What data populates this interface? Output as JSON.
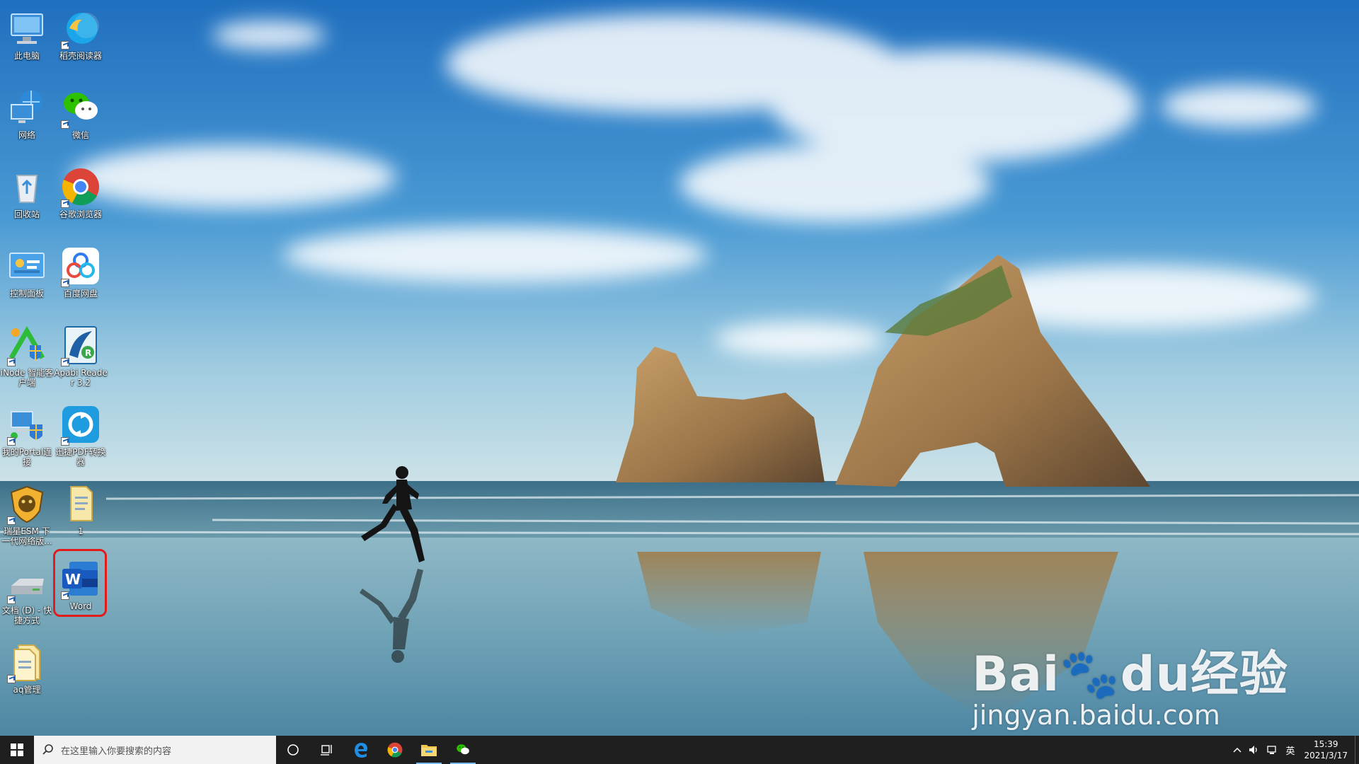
{
  "desktop": {
    "icons": [
      {
        "label": "此电脑",
        "icon": "computer-icon"
      },
      {
        "label": "稻壳阅读器",
        "icon": "reader-icon"
      },
      {
        "label": "网络",
        "icon": "network-icon"
      },
      {
        "label": "微信",
        "icon": "wechat-icon"
      },
      {
        "label": "回收站",
        "icon": "recycle-bin-icon"
      },
      {
        "label": "谷歌浏览器",
        "icon": "chrome-icon"
      },
      {
        "label": "控制面板",
        "icon": "control-panel-icon"
      },
      {
        "label": "百度网盘",
        "icon": "baidu-netdisk-icon"
      },
      {
        "label": "iNode 智能客户端",
        "icon": "inode-icon"
      },
      {
        "label": "Apabi Reader 3.2",
        "icon": "apabi-reader-icon"
      },
      {
        "label": "我的Portal连接",
        "icon": "portal-icon"
      },
      {
        "label": "迅捷PDF转换器",
        "icon": "pdf-converter-icon"
      },
      {
        "label": "瑞星ESM 下一代网络版...",
        "icon": "rising-esm-icon"
      },
      {
        "label": "1",
        "icon": "document-icon"
      },
      {
        "label": "文档 (D) - 快捷方式",
        "icon": "drive-icon"
      },
      {
        "label": "Word",
        "icon": "word-icon"
      },
      {
        "label": "aq管理",
        "icon": "folder-doc-icon"
      }
    ]
  },
  "watermark": {
    "brand": "Bai🐾du经验",
    "url": "jingyan.baidu.com"
  },
  "taskbar": {
    "search_placeholder": "在这里输入你要搜索的内容",
    "tray_lang": "英",
    "time": "15:39",
    "date": "2021/3/17"
  },
  "colors": {
    "taskbar_bg": "#1f1f1f",
    "highlight": "#e21b1b",
    "word_blue": "#2b579a"
  }
}
